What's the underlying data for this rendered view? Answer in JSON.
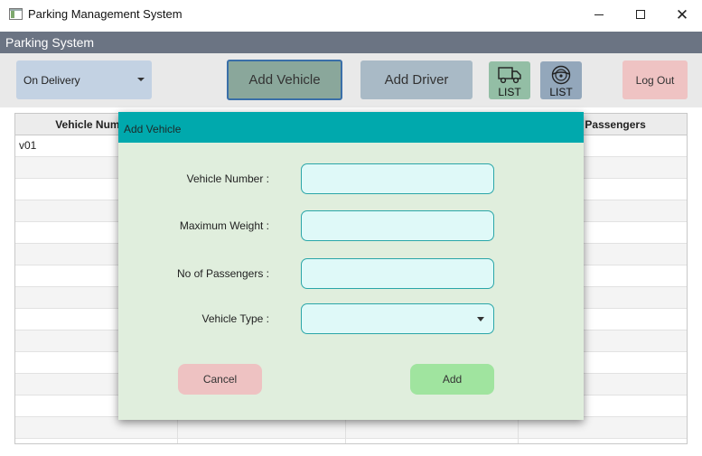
{
  "window": {
    "title": "Parking Management System",
    "minimize_icon": "minimize-icon",
    "maximize_icon": "maximize-icon",
    "close_icon": "close-icon"
  },
  "app_header": {
    "title": "Parking System"
  },
  "toolbar": {
    "status_combo": {
      "selected": "On Delivery"
    },
    "add_vehicle_label": "Add Vehicle",
    "add_driver_label": "Add Driver",
    "vehicle_list": {
      "icon": "truck-icon",
      "label": "LIST"
    },
    "driver_list": {
      "icon": "steering-wheel-icon",
      "label": "LIST"
    },
    "logout_label": "Log Out"
  },
  "table": {
    "columns": [
      "Vehicle Number",
      "",
      "",
      "No of Passengers"
    ],
    "rows": [
      [
        "v01",
        "",
        "",
        ""
      ],
      [
        "",
        "",
        "",
        ""
      ],
      [
        "",
        "",
        "",
        ""
      ],
      [
        "",
        "",
        "",
        ""
      ],
      [
        "",
        "",
        "",
        ""
      ],
      [
        "",
        "",
        "",
        ""
      ],
      [
        "",
        "",
        "",
        ""
      ],
      [
        "",
        "",
        "",
        ""
      ],
      [
        "",
        "",
        "",
        ""
      ],
      [
        "",
        "",
        "",
        ""
      ],
      [
        "",
        "",
        "",
        ""
      ],
      [
        "",
        "",
        "",
        ""
      ],
      [
        "",
        "",
        "",
        ""
      ],
      [
        "",
        "",
        "",
        ""
      ],
      [
        "",
        "",
        "",
        ""
      ]
    ]
  },
  "dialog": {
    "title": "Add Vehicle",
    "fields": {
      "vehicle_number": {
        "label": "Vehicle Number :",
        "value": ""
      },
      "maximum_weight": {
        "label": "Maximum Weight :",
        "value": ""
      },
      "passengers": {
        "label": "No of Passengers :",
        "value": ""
      },
      "vehicle_type": {
        "label": "Vehicle Type :",
        "value": ""
      }
    },
    "cancel_label": "Cancel",
    "add_label": "Add"
  },
  "colors": {
    "header_bar": "#6b7483",
    "dialog_header": "#00a9ad",
    "dialog_body": "#e0eedd",
    "field_bg": "#dff9f8",
    "cancel_bg": "#eec2c2",
    "add_bg": "#a0e49f"
  }
}
